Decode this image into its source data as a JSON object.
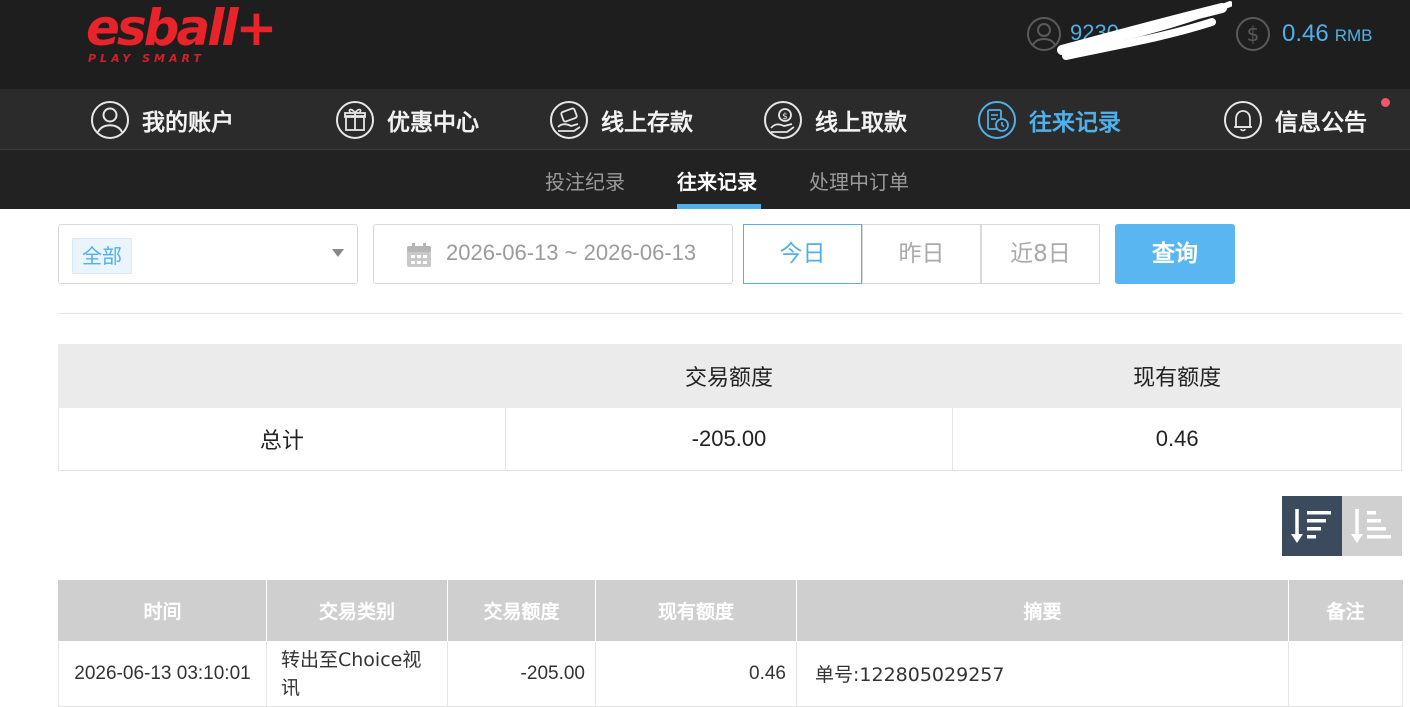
{
  "brand": {
    "logo_text": "esball+",
    "tagline": "PLAY SMART"
  },
  "header": {
    "username": "9230",
    "balance": "0.46",
    "currency": "RMB",
    "accent_color": "#4fb0ea"
  },
  "nav": {
    "items": [
      {
        "label": "我的账户",
        "icon": "user-icon"
      },
      {
        "label": "优惠中心",
        "icon": "gift-icon"
      },
      {
        "label": "线上存款",
        "icon": "deposit-icon"
      },
      {
        "label": "线上取款",
        "icon": "withdraw-icon"
      },
      {
        "label": "往来记录",
        "icon": "records-icon",
        "active": true
      },
      {
        "label": "信息公告",
        "icon": "bell-icon"
      }
    ]
  },
  "subnav": {
    "items": [
      {
        "label": "投注纪录"
      },
      {
        "label": "往来记录",
        "active": true
      },
      {
        "label": "处理中订单"
      }
    ]
  },
  "filters": {
    "type_selected": "全部",
    "date_range": "2026-06-13 ~ 2026-06-13",
    "ranges": [
      "今日",
      "昨日",
      "近8日"
    ],
    "active_range": "今日",
    "query_label": "查询"
  },
  "summary": {
    "headers": [
      "",
      "交易额度",
      "现有额度"
    ],
    "row": {
      "label": "总计",
      "amount": "-205.00",
      "balance": "0.46"
    }
  },
  "records": {
    "headers": [
      "时间",
      "交易类别",
      "交易额度",
      "现有额度",
      "摘要",
      "备注"
    ],
    "rows": [
      {
        "time": "2026-06-13 03:10:01",
        "type": "转出至Choice视讯",
        "amount": "-205.00",
        "balance": "0.46",
        "memo": "单号:122805029257",
        "note": ""
      }
    ]
  }
}
